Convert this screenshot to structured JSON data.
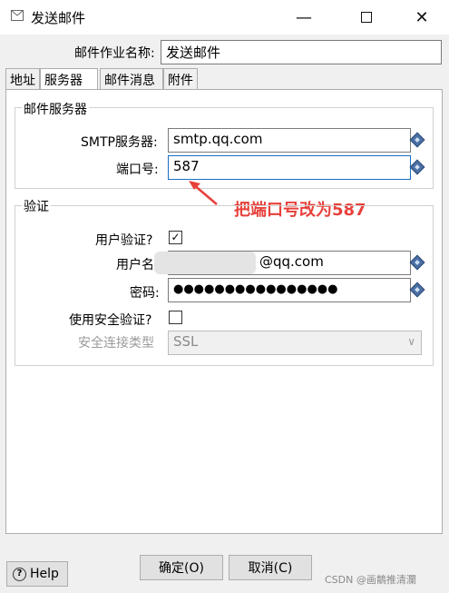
{
  "window": {
    "title": "发送邮件"
  },
  "job_name": {
    "label": "邮件作业名称:",
    "value": "发送邮件"
  },
  "tabs": [
    {
      "label": "地址"
    },
    {
      "label": "服务器"
    },
    {
      "label": "邮件消息"
    },
    {
      "label": "附件"
    }
  ],
  "server_group": {
    "title": "邮件服务器",
    "smtp_label": "SMTP服务器:",
    "smtp_value": "smtp.qq.com",
    "port_label": "端口号:",
    "port_value": "587"
  },
  "annotation": {
    "text": "把端口号改为587"
  },
  "auth_group": {
    "title": "验证",
    "use_auth_label": "用户验证?",
    "use_auth_checked": true,
    "username_label": "用户名",
    "username_value": "@qq.com",
    "password_label": "密码:",
    "password_value": "●●●●●●●●●●●●●●●●",
    "secure_label": "使用安全验证?",
    "secure_checked": false,
    "conn_type_label": "安全连接类型",
    "conn_type_value": "SSL"
  },
  "buttons": {
    "ok": "确定(O)",
    "cancel": "取消(C)",
    "help": "Help"
  },
  "watermark": "CSDN @画鶄推清瀾"
}
